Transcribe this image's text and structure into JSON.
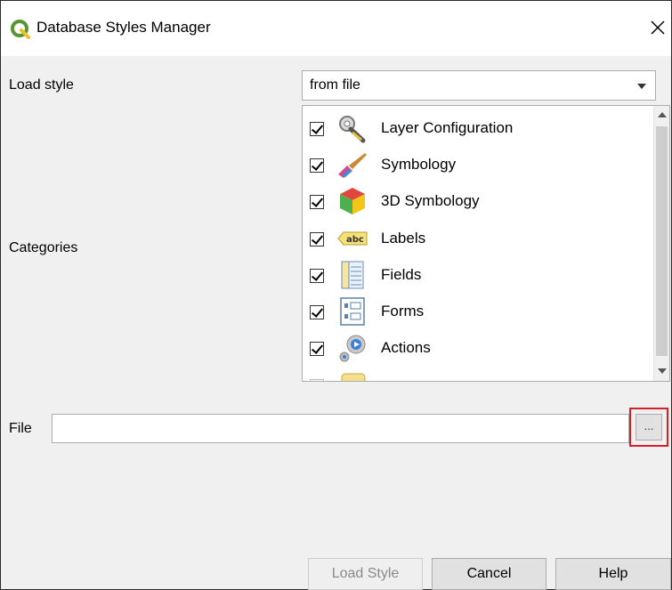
{
  "window": {
    "title": "Database Styles Manager"
  },
  "labels": {
    "load_style": "Load style",
    "categories": "Categories",
    "file": "File"
  },
  "load_style_combo": {
    "value": "from file"
  },
  "categories": [
    {
      "label": "Layer Configuration",
      "checked": true,
      "icon": "layer-configuration-icon"
    },
    {
      "label": "Symbology",
      "checked": true,
      "icon": "symbology-brush-icon"
    },
    {
      "label": "3D Symbology",
      "checked": true,
      "icon": "3d-cube-icon"
    },
    {
      "label": "Labels",
      "checked": true,
      "icon": "labels-abc-icon"
    },
    {
      "label": "Fields",
      "checked": true,
      "icon": "fields-icon"
    },
    {
      "label": "Forms",
      "checked": true,
      "icon": "forms-icon"
    },
    {
      "label": "Actions",
      "checked": true,
      "icon": "actions-icon"
    }
  ],
  "file_field": {
    "value": "",
    "browse_label": "..."
  },
  "buttons": {
    "load_style": "Load Style",
    "cancel": "Cancel",
    "help": "Help"
  },
  "colors": {
    "highlight": "#d61f26",
    "qgis_green": "#589632"
  }
}
